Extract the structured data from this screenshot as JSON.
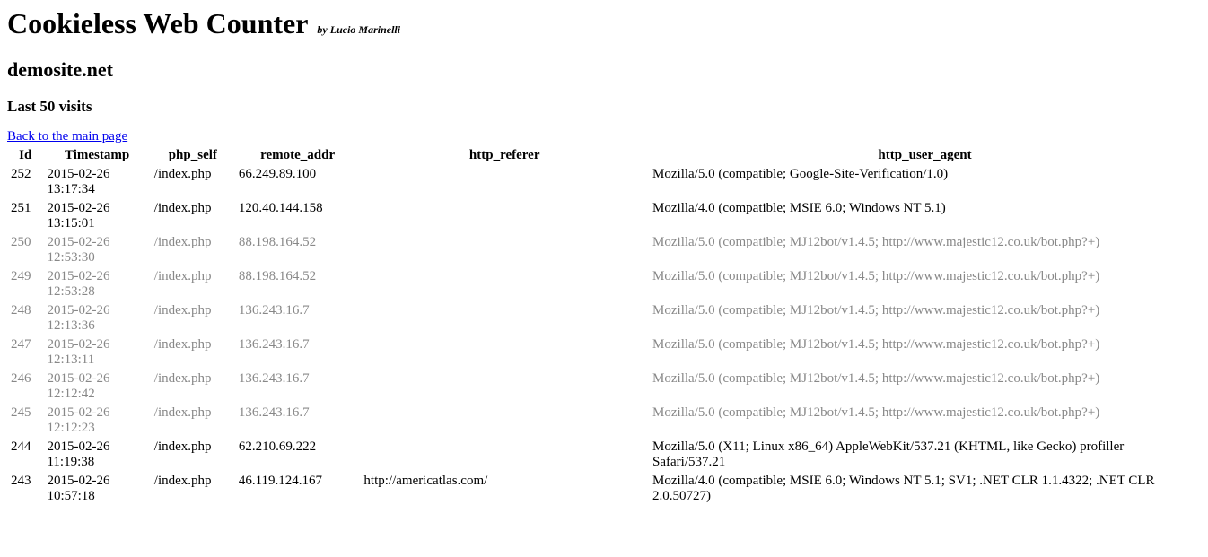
{
  "title": "Cookieless Web Counter",
  "byline": "by Lucio Marinelli",
  "site": "demosite.net",
  "subtitle": "Last 50 visits",
  "back_link": "Back to the main page",
  "columns": [
    "Id",
    "Timestamp",
    "php_self",
    "remote_addr",
    "http_referer",
    "http_user_agent"
  ],
  "rows": [
    {
      "id": "252",
      "ts": "2015-02-26 13:17:34",
      "self": "/index.php",
      "addr": "66.249.89.100",
      "ref": "",
      "ua": "Mozilla/5.0 (compatible; Google-Site-Verification/1.0)",
      "dimmed": false
    },
    {
      "id": "251",
      "ts": "2015-02-26 13:15:01",
      "self": "/index.php",
      "addr": "120.40.144.158",
      "ref": "",
      "ua": "Mozilla/4.0 (compatible; MSIE 6.0; Windows NT 5.1)",
      "dimmed": false
    },
    {
      "id": "250",
      "ts": "2015-02-26 12:53:30",
      "self": "/index.php",
      "addr": "88.198.164.52",
      "ref": "",
      "ua": "Mozilla/5.0 (compatible; MJ12bot/v1.4.5; http://www.majestic12.co.uk/bot.php?+)",
      "dimmed": true
    },
    {
      "id": "249",
      "ts": "2015-02-26 12:53:28",
      "self": "/index.php",
      "addr": "88.198.164.52",
      "ref": "",
      "ua": "Mozilla/5.0 (compatible; MJ12bot/v1.4.5; http://www.majestic12.co.uk/bot.php?+)",
      "dimmed": true
    },
    {
      "id": "248",
      "ts": "2015-02-26 12:13:36",
      "self": "/index.php",
      "addr": "136.243.16.7",
      "ref": "",
      "ua": "Mozilla/5.0 (compatible; MJ12bot/v1.4.5; http://www.majestic12.co.uk/bot.php?+)",
      "dimmed": true
    },
    {
      "id": "247",
      "ts": "2015-02-26 12:13:11",
      "self": "/index.php",
      "addr": "136.243.16.7",
      "ref": "",
      "ua": "Mozilla/5.0 (compatible; MJ12bot/v1.4.5; http://www.majestic12.co.uk/bot.php?+)",
      "dimmed": true
    },
    {
      "id": "246",
      "ts": "2015-02-26 12:12:42",
      "self": "/index.php",
      "addr": "136.243.16.7",
      "ref": "",
      "ua": "Mozilla/5.0 (compatible; MJ12bot/v1.4.5; http://www.majestic12.co.uk/bot.php?+)",
      "dimmed": true
    },
    {
      "id": "245",
      "ts": "2015-02-26 12:12:23",
      "self": "/index.php",
      "addr": "136.243.16.7",
      "ref": "",
      "ua": "Mozilla/5.0 (compatible; MJ12bot/v1.4.5; http://www.majestic12.co.uk/bot.php?+)",
      "dimmed": true
    },
    {
      "id": "244",
      "ts": "2015-02-26 11:19:38",
      "self": "/index.php",
      "addr": "62.210.69.222",
      "ref": "",
      "ua": "Mozilla/5.0 (X11; Linux x86_64) AppleWebKit/537.21 (KHTML, like Gecko) profiller Safari/537.21",
      "dimmed": false
    },
    {
      "id": "243",
      "ts": "2015-02-26 10:57:18",
      "self": "/index.php",
      "addr": "46.119.124.167",
      "ref": "http://americatlas.com/",
      "ua": "Mozilla/4.0 (compatible; MSIE 6.0; Windows NT 5.1; SV1; .NET CLR 1.1.4322; .NET CLR 2.0.50727)",
      "dimmed": false
    }
  ]
}
